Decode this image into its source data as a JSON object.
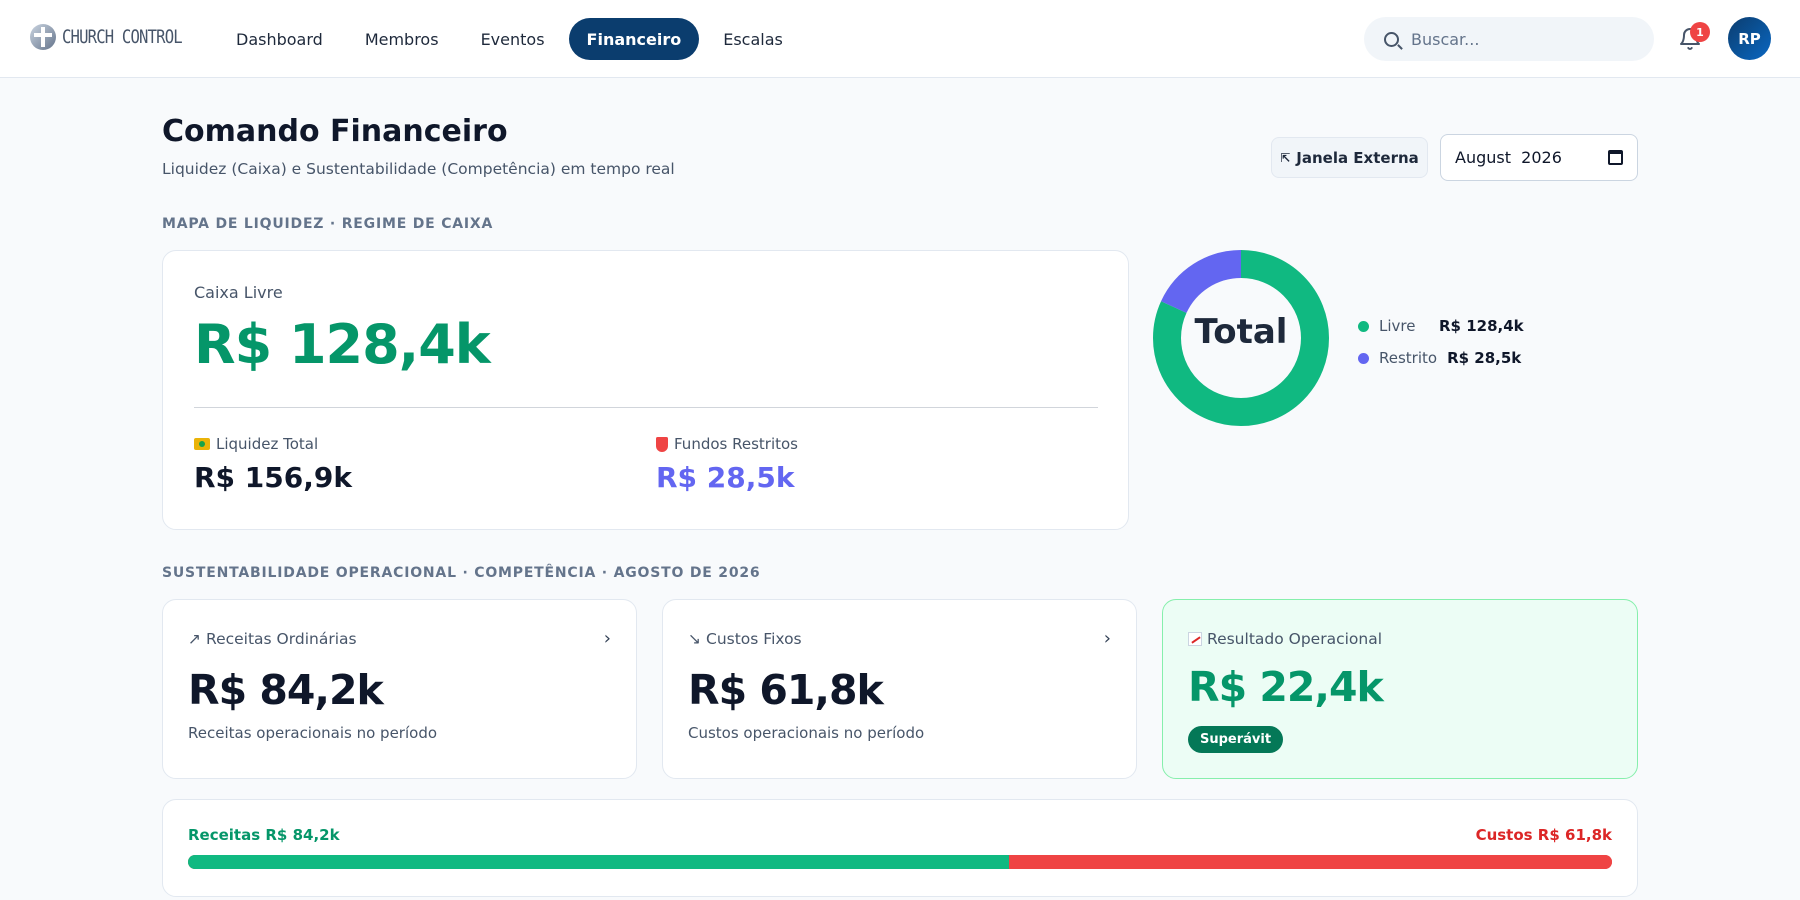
{
  "app": {
    "logo_text": "CHURCH CONTROL"
  },
  "nav": {
    "items": [
      {
        "label": "Dashboard"
      },
      {
        "label": "Membros"
      },
      {
        "label": "Eventos"
      },
      {
        "label": "Financeiro",
        "active": true
      },
      {
        "label": "Escalas"
      }
    ],
    "search_placeholder": "Buscar...",
    "notifications_count": "1",
    "avatar_initials": "RP"
  },
  "header": {
    "title": "Comando Financeiro",
    "subtitle": "Liquidez (Caixa) e Sustentabilidade (Competência) em tempo real",
    "external_button": "Janela Externa",
    "month_value": "August  2026"
  },
  "liquidity": {
    "section_label": "MAPA DE LIQUIDEZ · REGIME DE CAIXA",
    "free_label": "Caixa Livre",
    "free_value": "R$ 128,4k",
    "total_label": "Liquidez Total",
    "total_value": "R$ 156,9k",
    "restricted_label": "Fundos Restritos",
    "restricted_value": "R$ 28,5k",
    "donut": {
      "center_label": "Total",
      "slices": [
        {
          "name": "Livre",
          "value": 128.4,
          "display": "R$ 128,4k",
          "color": "#10b981"
        },
        {
          "name": "Restrito",
          "value": 28.5,
          "display": "R$ 28,5k",
          "color": "#6366f1"
        }
      ]
    }
  },
  "sustainability": {
    "section_label": "SUSTENTABILIDADE OPERACIONAL · COMPETÊNCIA · AGOSTO DE 2026",
    "revenue": {
      "label": "Receitas Ordinárias",
      "value": "R$ 84,2k",
      "desc": "Receitas operacionais no período",
      "icon": "↗"
    },
    "costs": {
      "label": "Custos Fixos",
      "value": "R$ 61,8k",
      "desc": "Custos operacionais no período",
      "icon": "↘"
    },
    "result": {
      "label": "Resultado Operacional",
      "value": "R$ 22,4k",
      "badge": "Superávit"
    },
    "bar": {
      "revenue_label": "Receitas R$ 84,2k",
      "costs_label": "Custos R$ 61,8k",
      "revenue_value": 84.2,
      "costs_value": 61.8
    }
  },
  "colors": {
    "primary": "#0b3d6e",
    "green": "#059669",
    "indigo": "#6366f1",
    "red": "#dc2626"
  }
}
